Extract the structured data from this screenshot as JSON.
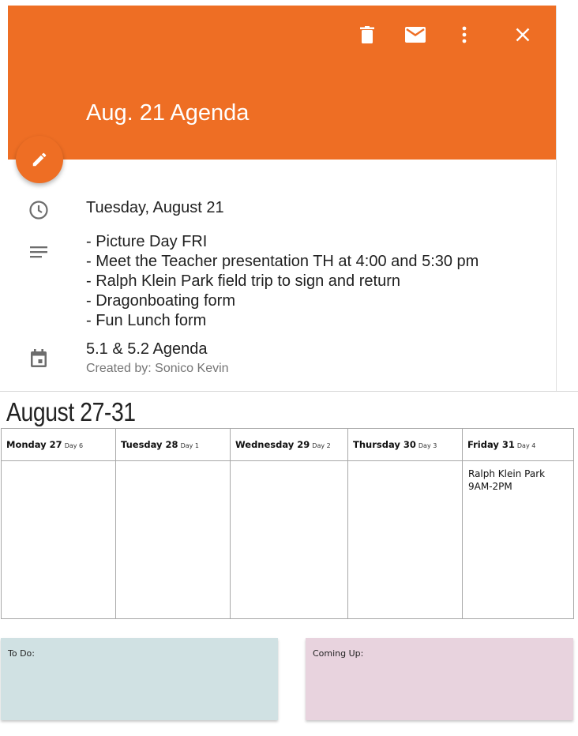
{
  "event": {
    "title": "Aug. 21 Agenda",
    "date": "Tuesday, August 21",
    "description_lines": [
      "- Picture Day FRI",
      "- Meet the Teacher presentation TH at 4:00 and 5:30 pm",
      "- Ralph Klein Park field trip to sign and return",
      "- Dragonboating form",
      "- Fun Lunch form"
    ],
    "calendar_name": "5.1 & 5.2 Agenda",
    "created_by": "Created by: Sonico Kevin",
    "toolbar_icons": [
      "delete-icon",
      "email-icon",
      "more-vert-icon",
      "close-icon"
    ],
    "accent_color": "#ee6e24"
  },
  "week": {
    "title": "August 27-31",
    "days": [
      {
        "name": "Monday 27",
        "day_num": "Day 6",
        "event": ""
      },
      {
        "name": "Tuesday 28",
        "day_num": "Day 1",
        "event": ""
      },
      {
        "name": "Wednesday 29",
        "day_num": "Day 2",
        "event": ""
      },
      {
        "name": "Thursday 30",
        "day_num": "Day 3",
        "event": ""
      },
      {
        "name": "Friday 31",
        "day_num": "Day 4",
        "event": "Ralph Klein Park 9AM-2PM"
      }
    ]
  },
  "notes": {
    "todo_label": "To Do:",
    "todo_color": "#d0e1e3",
    "coming_label": "Coming Up:",
    "coming_color": "#e8d3de"
  }
}
